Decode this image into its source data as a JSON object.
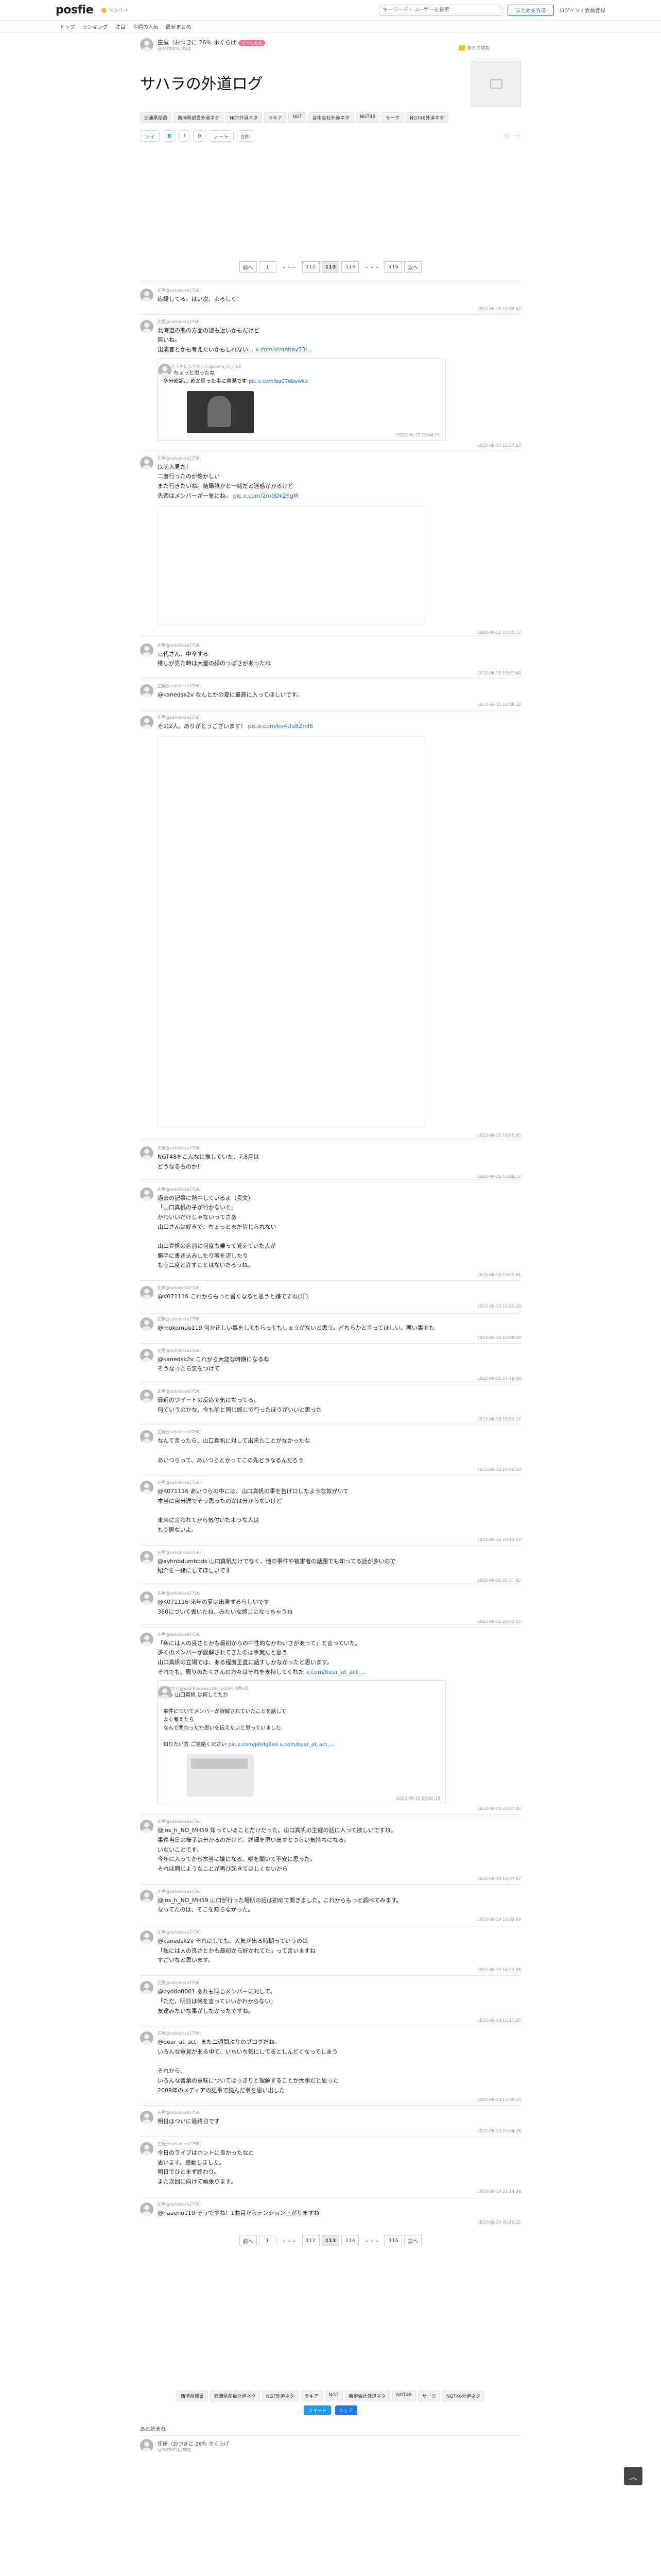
{
  "header": {
    "logo": "posfie",
    "powered_by": "Togetter",
    "search_placeholder": "キーワード・ユーザーを検索",
    "create_label": "まとめを作る",
    "login_label": "ログイン / 会員登録"
  },
  "subnav": [
    "トップ",
    "ランキング",
    "注目",
    "今週の人気",
    "最新まとめ"
  ],
  "author": {
    "name": "庄屋（おつきに 26％ ホくらげ",
    "handle": "@tomoru_ttag",
    "pill": "もっと見る",
    "follow": "あとで読む"
  },
  "title": "サハラの外道ログ",
  "tags": [
    "西浦県部員",
    "西浦県部員外道ネタ",
    "NGT外道ネタ",
    "ラキア",
    "NGT",
    "芸術会社外道ネタ",
    "NGT48",
    "サーク",
    "NGT48外道ネタ"
  ],
  "share": {
    "twitter": "ツイ",
    "hatena": "B",
    "fb": "f",
    "line": "0",
    "note": "ノート",
    "count": "0件"
  },
  "pager": {
    "prev": "前へ",
    "first": "1",
    "dots": "・・・",
    "pages": [
      "112",
      "113",
      "114"
    ],
    "last": "116",
    "next": "次へ",
    "current": "113"
  },
  "posts": [
    {
      "meta": "庄屋@sahahara2756",
      "body": "応援してる。はい次、よろしく！",
      "time": "2023-06-15 11:08:42"
    },
    {
      "meta": "庄屋@sahahara2756",
      "body": "北海道の熊の方面の旅も近いかもだけど\n無いね。\n出演者とかも考えたいかもしれない...",
      "link": "x.com/ichinbay13/...",
      "time": "2023-06-15 12:57:03"
    },
    {
      "meta": "庄屋@sahahara2756",
      "body": "以前入見た！\n二度行ったのが懐かしい\nまた行きたいね。結局誰かと一緒だと迷惑かかるけど\n先週はメンバーが一気にね。",
      "link": "pic.x.com/2m9Dk2SgM",
      "time": "2023-06-15 13:05:12"
    },
    {
      "meta": "庄屋@sahahara2756",
      "body": "三代さん、中卒する\n推しが見た時は大量の緑のっぽさがあったね",
      "time": "2023-06-15 18:07:44"
    },
    {
      "meta": "庄屋@sahahara2756",
      "body": "@kanedsk2v なんとかの夏に最高に入ってほしいです。",
      "time": "2023-06-15 18:08:22"
    },
    {
      "meta": "庄屋@sahahara2756",
      "body": "その2人。ありがとうございます！",
      "link": "pic.x.com/ke4Ua8Zml6",
      "time": "2023-06-15 18:40:45"
    },
    {
      "meta": "庄屋@sahahara2756",
      "body": "NGT48をこんなに推していた、7.8月は\nどうなるものか！",
      "time": "2023-06-16 10:09:22"
    },
    {
      "meta": "庄屋@sahahara2756",
      "body": "過去の記事に熱中しているよ（長文）\n「山口真帆の子が行かないと」\nかわいいだけじゃないってさあ\n山口さんは好きで、ちょっとまだ信じられない\n\n山口真帆の名前に何度も乗って覚えていた人が\n勝手に書き込みしたり噂を流したり\nもう二度と許すことはないだろうね。",
      "time": "2023-06-16 10:39:41"
    },
    {
      "meta": "庄屋@sahahara2756",
      "body": "@K071116 これからもっと書くなると思うと嫌ですね(汗)",
      "time": "2023-06-16 11:00:20"
    },
    {
      "meta": "庄屋@sahahara2756",
      "body": "@mokemuo119 何か正しい事をしてもらってもしょうがないと思う。どちらかと言ってほしい、悪い事でも",
      "time": "2023-06-16 12:05:33"
    },
    {
      "meta": "庄屋@sahahara2756",
      "body": "@kanedsk2v これから大変な時期になるね\nそうなったら気をつけて",
      "time": "2023-06-16 14:16:08"
    },
    {
      "meta": "庄屋@sahahara2756",
      "body": "最近のツイートの反応で気になってる。\n何ていうのかな、今も前と同じ感じで行ったほうがいいと思った",
      "time": "2023-06-16 16:10:12"
    },
    {
      "meta": "庄屋@sahahara2756",
      "body": "なんて言ったら、山口真帆に対して出来たことがなかったな\n\nあいつらって、あいつらとかってこの先どうなるんだろう",
      "time": "2023-06-16 17:46:03"
    },
    {
      "meta": "庄屋@sahahara2756",
      "body": "@K071116 あいつらの中には、山口真帆の事を告げ口したような奴がいて\n本当に自分達でそう思ったのかは分からないけど\n\n未来に言われてから気付いたような人は\nもう居ないよ。",
      "time": "2023-06-16 20:13:07"
    },
    {
      "meta": "庄屋@sahahara2756",
      "body": "@ayhnbdumbbds 山口真帆だけでなく、他の事件や被害者の話題でも知ってる話が多いので\n紹介を一緒にしてほしいです",
      "time": "2023-06-16 21:01:42"
    },
    {
      "meta": "庄屋@sahahara2756",
      "body": "@K071116 来年の夏は出演するらしいです\n360について書いたね、みたいな感じになっちゃうね",
      "time": "2023-06-16 23:02:05"
    },
    {
      "meta": "庄屋@sahahara2756",
      "body": "「私には人の良さとかも最初からの中性的なかわいさがあって」と言っていた。\n多くのメンバーが誤解されてきたのは事実だと思う\n山口真帆の立場では、ある程度正直に話すしかなかったと思います。\nそれでも、周りのたくさんの方々はそれを支持してくれた",
      "link": "x.com/bear_at_act_...",
      "time": "2023-06-18 08:07:55"
    },
    {
      "meta": "庄屋@sahahara2756",
      "body": "@jos_h_NO_MH59 知っていることだけだった。山口真帆の主催の話に入って欲しいですね。\n事件当日の様子は分かるのだけど、詳細を思い出すとつらい気持ちになる。\nいないことです。\n今年に入ってから本当に嫌になる、噂を聞いて不安に思った。\nそれは同じようなことが再び起きてほしくないから",
      "time": "2023-06-19 10:07:07"
    },
    {
      "meta": "庄屋@sahahara2756",
      "body": "@jos_h_NO_MH59 山口が行った場所の話は初めて聞きました。これからもっと調べてみます。\nなってたのは、そこを知らなかった。",
      "time": "2023-06-19 12:03:09"
    },
    {
      "meta": "庄屋@sahahara2756",
      "body": "@kanedsk2v それにしても、人気が出る時期っていうのは\n「私には人の良さとかも最初から好かれてた」って言いますね\nすごいなと思います。",
      "time": "2023-06-19 14:22:26"
    },
    {
      "meta": "庄屋@sahahara2756",
      "body": "@byddo0001 あれも同じメンバーに対して、\n「ただ、明日は何を言っていいかわからない」\n友達みたいな事がしたかったですね。",
      "time": "2023-06-19 15:11:05"
    },
    {
      "meta": "庄屋@sahahara2756",
      "body": "@bear_at_act_ また二週間ぶりのブログだね。\nいろんな意見がある中で、いちいち気にしてるとしんどくなってしまう\n\nそれから、\nいろんな言葉の意味についてはっきりと理解することが大事だと思った\n2009年のメディアの記事で読んだ事を思い出した",
      "time": "2023-06-19 17:05:24"
    },
    {
      "meta": "庄屋@sahahara2756",
      "body": "明日はついに最終日です",
      "time": "2023-06-19 19:04:26"
    },
    {
      "meta": "庄屋@sahahara2756",
      "body": "今日のライブはホントに良かったなと\n思います。感動しました。\n明日でひとまず終わり。\nまた次回に向けて頑張ります。",
      "time": "2023-06-19 22:14:38"
    },
    {
      "meta": "庄屋@sahahara2756",
      "body": "@haaeno119 そうですね！1曲目からテンション上がりますね",
      "time": "2023-06-20 00:16:25"
    }
  ],
  "embeds": [
    {
      "meta": "なんと人生に入りたい人@name_in_life2",
      "text": "あ、ちょっと思ったね\n多分確認... 確か思った事に意見です",
      "link": "pic.x.com/bsC7obuwkx",
      "time": "2023-06-15 10:44:21"
    },
    {
      "meta": "高木さん@aaddhouses119 · 2019年1月9日",
      "text": "にゃ 山口真帆 は何してたか\n\n事件についてメンバーが誤解されていたことを話して\nよく考えたら\nなんで関わったか思いを伝えたいと思っていました\n\n知りたい方 ご連絡ください",
      "link": "pic.x.com/phHg6eo x.com/bear_at_act_...",
      "time": "2023-06-18 08:02:18"
    }
  ],
  "footer": {
    "tweet": "ツイート",
    "share": "シェア",
    "related_label": "あと読まれ",
    "related_title": "庄屋（おつきに 26％ ホくらげ",
    "related_handle": "@tomoru_ttag"
  },
  "colors": {
    "accent": "#1a73e8",
    "pill": "#ff6f91",
    "logo_accent": "#e65a5a"
  }
}
